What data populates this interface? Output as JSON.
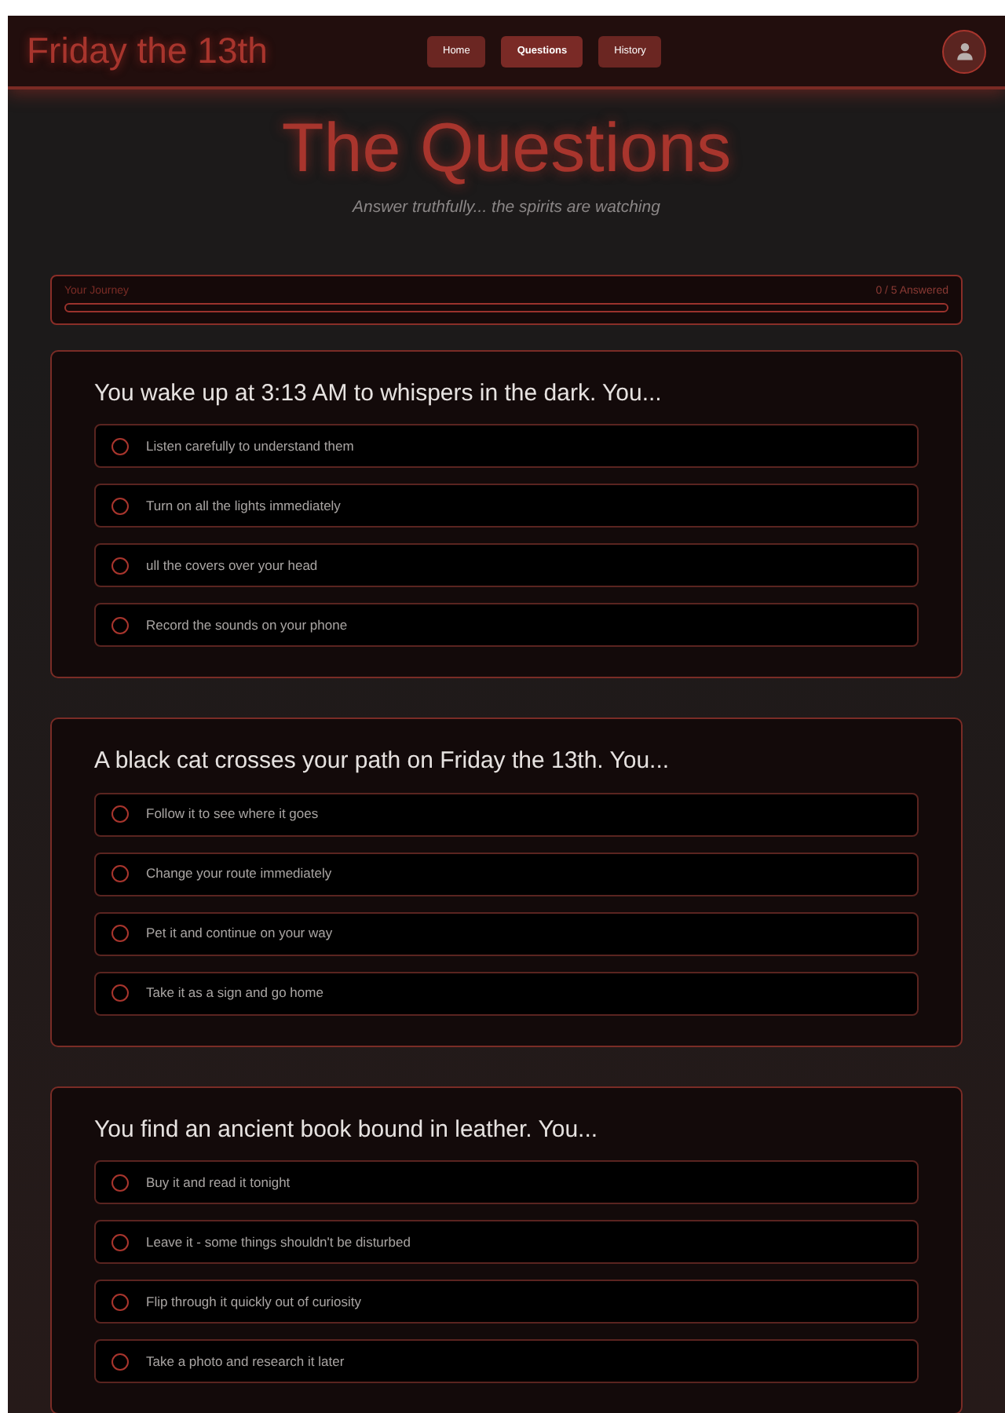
{
  "header": {
    "brand": "Friday the 13th",
    "nav": [
      {
        "label": "Home",
        "selected": false
      },
      {
        "label": "Questions",
        "selected": true
      },
      {
        "label": "History",
        "selected": false
      }
    ]
  },
  "hero": {
    "title": "The Questions",
    "subtitle": "Answer truthfully... the spirits are watching"
  },
  "progress": {
    "label": "Your Journey",
    "count": "0 / 5 Answered",
    "level": 0
  },
  "questions": [
    {
      "text": "You wake up at 3:13 AM to whispers in the dark. You...",
      "options": [
        {
          "label": "Listen carefully to understand them",
          "selected": false
        },
        {
          "label": "Turn on all the lights immediately",
          "selected": false
        },
        {
          "label": "ull the covers over your head",
          "selected": false
        },
        {
          "label": "Record the sounds on your phone",
          "selected": false
        }
      ]
    },
    {
      "text": "A black cat crosses your path on Friday the 13th. You...",
      "options": [
        {
          "label": "Follow it to see where it goes",
          "selected": false
        },
        {
          "label": "Change your route immediately",
          "selected": false
        },
        {
          "label": "Pet it and continue on your way",
          "selected": false
        },
        {
          "label": "Take it as a sign and go home",
          "selected": false
        }
      ]
    },
    {
      "text": "You find an ancient book bound in leather. You...",
      "options": [
        {
          "label": "Buy it and read it tonight",
          "selected": false
        },
        {
          "label": "Leave it - some things shouldn't be disturbed",
          "selected": false
        },
        {
          "label": "Flip through it quickly out of curiosity",
          "selected": false
        },
        {
          "label": "Take a photo and research it later",
          "selected": false
        }
      ]
    }
  ]
}
